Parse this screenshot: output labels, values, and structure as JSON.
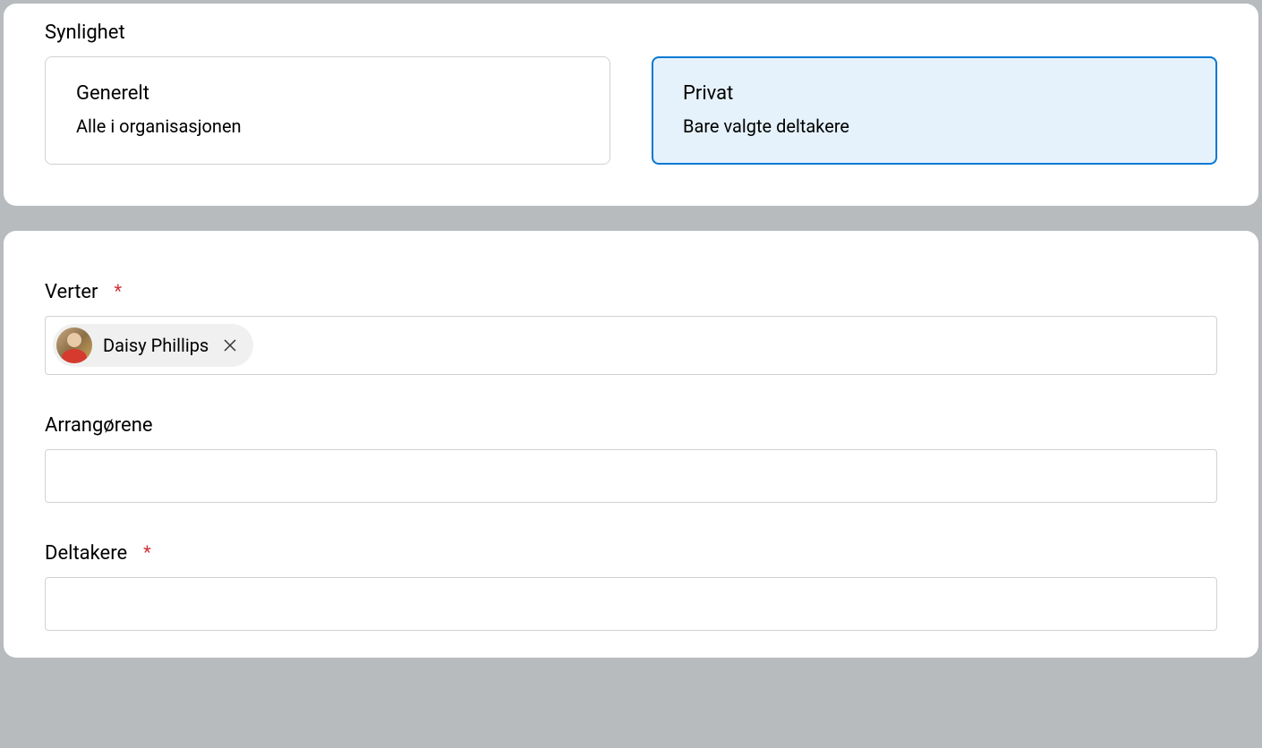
{
  "visibility": {
    "label": "Synlighet",
    "options": [
      {
        "title": "Generelt",
        "desc": "Alle i organisasjonen",
        "selected": false
      },
      {
        "title": "Privat",
        "desc": "Bare valgte deltakere",
        "selected": true
      }
    ]
  },
  "hosts": {
    "label": "Verter",
    "required": "*",
    "chips": [
      {
        "name": "Daisy Phillips"
      }
    ]
  },
  "organizers": {
    "label": "Arrangørene"
  },
  "participants": {
    "label": "Deltakere",
    "required": "*"
  }
}
